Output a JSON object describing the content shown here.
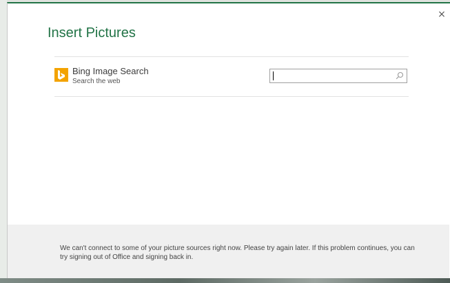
{
  "dialog": {
    "title": "Insert Pictures",
    "close_label": "×"
  },
  "source": {
    "name": "Bing Image Search",
    "subtitle": "Search the web",
    "search": {
      "value": "",
      "placeholder": ""
    }
  },
  "footer": {
    "message": "We can't connect to some of your picture sources right now. Please try again later. If this problem continues, you can try signing out of Office and signing back in."
  },
  "colors": {
    "accent": "#217346",
    "bing_icon_bg": "#f3a300",
    "footer_bg": "#f0f0f0"
  },
  "icons": [
    "close-icon",
    "bing-icon",
    "search-icon"
  ]
}
